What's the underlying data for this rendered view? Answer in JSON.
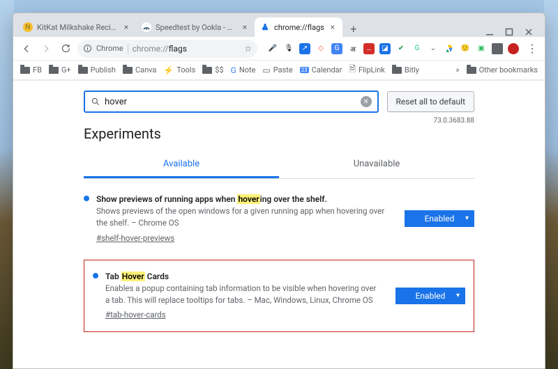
{
  "tabs": [
    {
      "title": "KitKat Milkshake Recipe - Easy H..."
    },
    {
      "title": "Speedtest by Ookla - The Global..."
    },
    {
      "title": "chrome://flags"
    }
  ],
  "omnibox": {
    "chip": "Chrome",
    "url_prefix": "chrome://",
    "url_path": "flags"
  },
  "bookmarks": {
    "items": [
      "FB",
      "G+",
      "Publish",
      "Canva",
      "Tools",
      "$$",
      "Note",
      "Paste",
      "Calendar",
      "FlipLink",
      "Bitly"
    ],
    "other": "Other bookmarks"
  },
  "flags": {
    "search_value": "hover",
    "reset_label": "Reset all to default",
    "heading": "Experiments",
    "version": "73.0.3683.88",
    "tab_available": "Available",
    "tab_unavailable": "Unavailable",
    "list": [
      {
        "title_pre": "Show previews of running apps when ",
        "title_hl": "hover",
        "title_post": "ing over the shelf.",
        "desc": "Shows previews of the open windows for a given running app when hovering over the shelf. – Chrome OS",
        "hash": "#shelf-hover-previews",
        "state": "Enabled"
      },
      {
        "title_pre": "Tab ",
        "title_hl": "Hover",
        "title_post": " Cards",
        "desc": "Enables a popup containing tab information to be visible when hovering over a tab. This will replace tooltips for tabs. – Mac, Windows, Linux, Chrome OS",
        "hash": "#tab-hover-cards",
        "state": "Enabled"
      }
    ]
  }
}
